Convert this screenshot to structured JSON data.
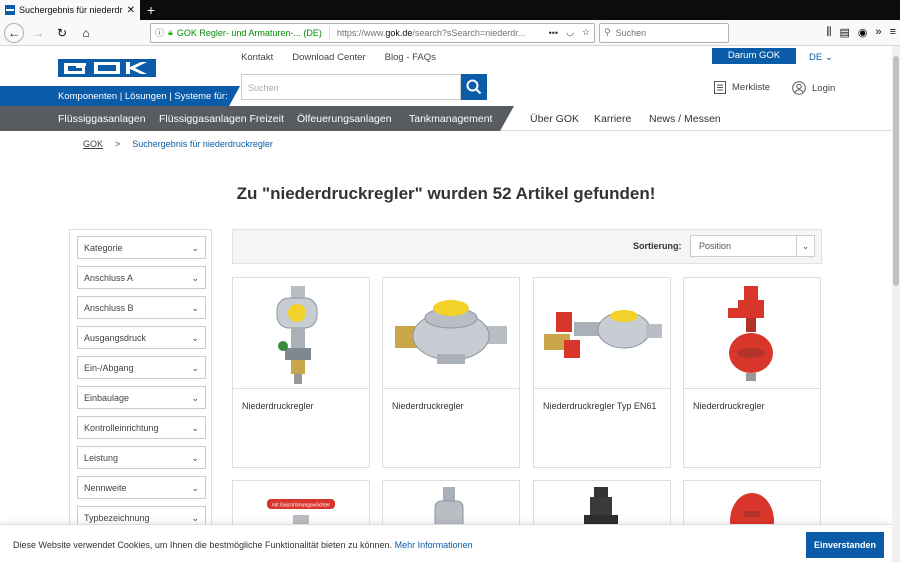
{
  "browser": {
    "tab_title": "Suchergebnis für niederdruckregler",
    "new_tab": "+",
    "site_identity": "GOK Regler- und Armaturen-... (DE)",
    "url_prefix": "https://www.",
    "url_domain": "gok.de",
    "url_rest": "/search?sSearch=niederdr...",
    "search_placeholder": "Suchen",
    "page_actions": "•••"
  },
  "header": {
    "tagline": "Komponenten | Lösungen | Systeme für:",
    "top_links": [
      "Kontakt",
      "Download Center",
      "Blog - FAQs"
    ],
    "darum": "Darum GOK",
    "lang": "DE",
    "search_placeholder": "Suchen",
    "merkliste": "Merkliste",
    "login": "Login"
  },
  "nav": {
    "dark_items": [
      "Flüssiggasanlagen",
      "Flüssiggasanlagen Freizeit",
      "Ölfeuerungsanlagen",
      "Tankmanagement"
    ],
    "light_items": [
      "Über GOK",
      "Karriere",
      "News / Messen"
    ]
  },
  "breadcrumb": {
    "home": "GOK",
    "arrow": ">",
    "current": "Suchergebnis für niederdruckregler"
  },
  "heading": "Zu \"niederdruckregler\" wurden 52 Artikel gefunden!",
  "filters": [
    "Kategorie",
    "Anschluss A",
    "Anschluss B",
    "Ausgangsdruck",
    "Ein-/Abgang",
    "Einbaulage",
    "Kontrolleinrichtung",
    "Leistung",
    "Nennweite",
    "Typbezeichnung"
  ],
  "sort": {
    "label": "Sortierung:",
    "value": "Position"
  },
  "products": [
    {
      "name": "Niederdruckregler"
    },
    {
      "name": "Niederdruckregler"
    },
    {
      "name": "Niederdruckregler Typ EN61"
    },
    {
      "name": "Niederdruckregler"
    }
  ],
  "second_row_badge": "mit Gasströmungswächter",
  "cookie": {
    "text": "Diese Website verwendet Cookies, um Ihnen die bestmögliche Funktionalität bieten zu können.",
    "more": "Mehr Informationen",
    "accept": "Einverstanden"
  },
  "colors": {
    "brand_blue": "#0a5ca8",
    "nav_dark": "#585c60",
    "regulator_red": "#d9362b",
    "cap_yellow": "#f2d22a"
  }
}
